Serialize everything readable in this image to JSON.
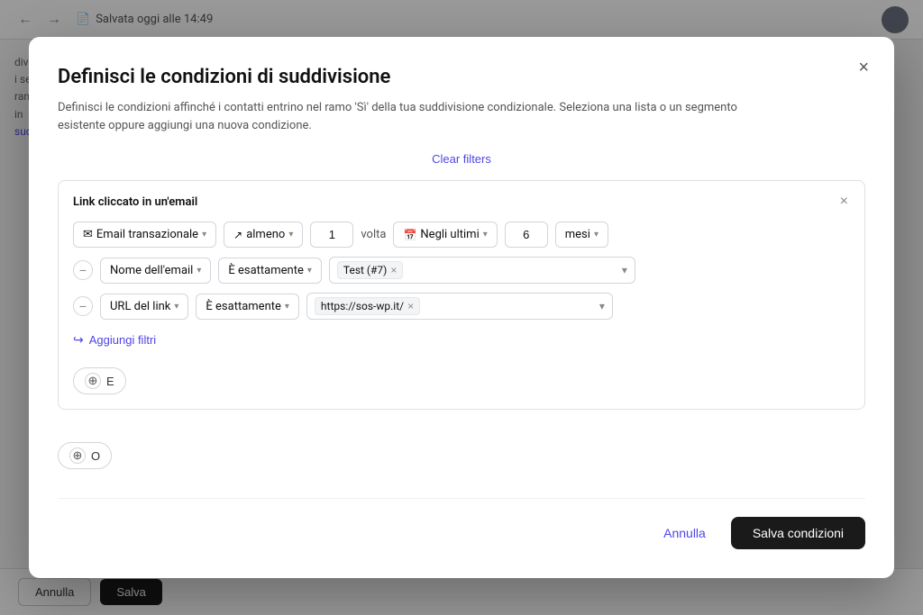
{
  "topbar": {
    "saved_text": "Salvata oggi alle 14:49",
    "back_label": "←",
    "forward_label": "→"
  },
  "sidebar": {
    "lines": [
      "divisi",
      "i se",
      "ramo",
      "in",
      "suc"
    ]
  },
  "bottom_bar": {
    "annulla_label": "Annulla",
    "salva_label": "Salva"
  },
  "modal": {
    "title": "Definisci le condizioni di suddivisione",
    "description": "Definisci le condizioni affinché i contatti entrino nel ramo 'Sì' della tua suddivisione condizionale. Seleziona una lista o un segmento esistente oppure aggiungi una nuova condizione.",
    "close_label": "×",
    "clear_filters_label": "Clear filters",
    "condition_card": {
      "title": "Link cliccato in un'email",
      "close_label": "×",
      "email_type_label": "Email transazionale",
      "frequency_label": "almeno",
      "frequency_count": "1",
      "frequency_unit": "volta",
      "time_label": "Negli ultimi",
      "time_value": "6",
      "time_unit": "mesi",
      "filter_row1": {
        "field_label": "Nome dell'email",
        "operator_label": "È esattamente",
        "tag_value": "Test (#7)",
        "tag_remove": "×"
      },
      "filter_row2": {
        "field_label": "URL del link",
        "operator_label": "È esattamente",
        "tag_value": "https://sos-wp.it/",
        "tag_remove": "×"
      },
      "add_filters_label": "Aggiungi filtri"
    },
    "and_button_label": "E",
    "or_button_label": "O",
    "footer": {
      "annulla_label": "Annulla",
      "salva_label": "Salva condizioni"
    }
  }
}
